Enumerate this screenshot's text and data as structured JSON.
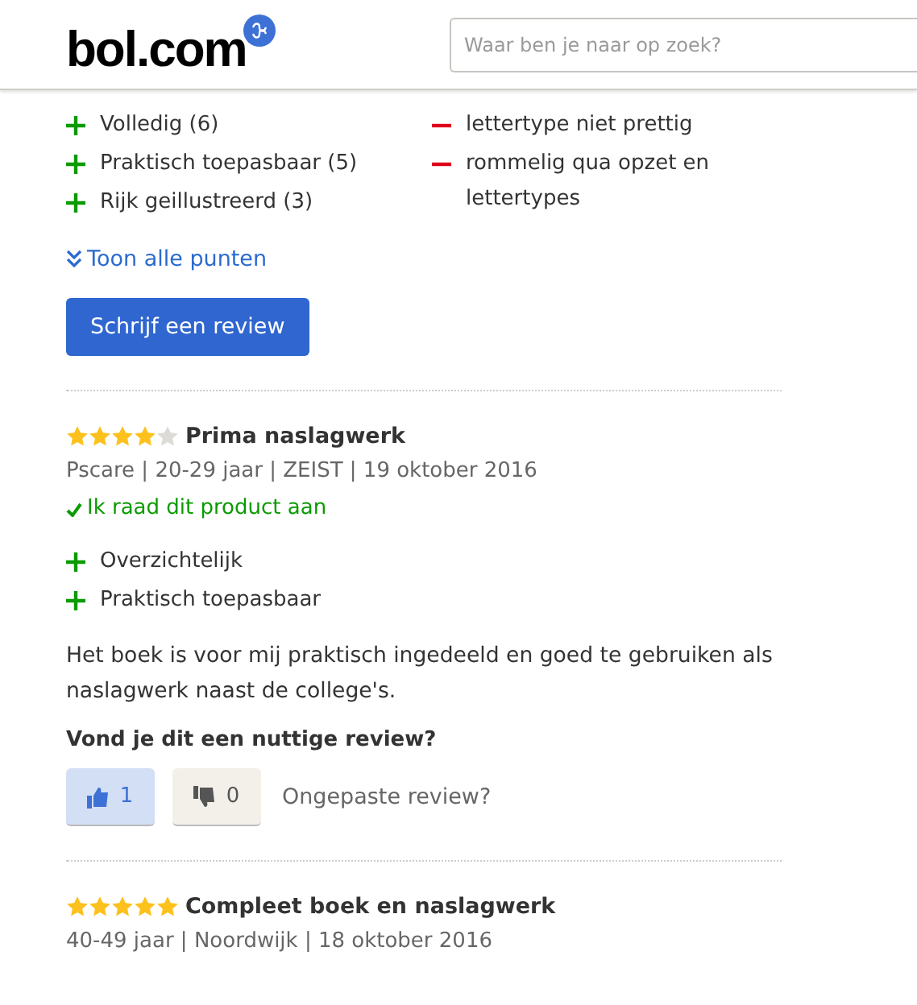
{
  "header": {
    "logo": "bol.com",
    "search": {
      "placeholder": "Waar ben je naar op zoek?"
    }
  },
  "summary": {
    "pros": [
      "Volledig (6)",
      "Praktisch toepasbaar (5)",
      "Rijk geillustreerd (3)"
    ],
    "cons": [
      "lettertype niet prettig",
      "rommelig qua opzet en lettertypes"
    ],
    "show_all": "Toon alle punten",
    "write_button": "Schrijf een review"
  },
  "reviews": [
    {
      "stars": 4,
      "title": "Prima naslagwerk",
      "meta": "Pscare | 20-29 jaar | ZEIST | 19 oktober 2016",
      "recommend": "Ik raad dit product aan",
      "pros": [
        "Overzichtelijk",
        "Praktisch toepasbaar"
      ],
      "body": "Het boek is voor mij praktisch ingedeeld en goed te gebruiken als naslagwerk naast de college's.",
      "question": "Vond je dit een nuttige review?",
      "votes": [
        {
          "kind": "up",
          "count": "1",
          "selected": true
        },
        {
          "kind": "down",
          "count": "0",
          "selected": false
        }
      ],
      "report": "Ongepaste review?"
    },
    {
      "stars": 5,
      "title": "Compleet boek en naslagwerk",
      "meta": "40-49 jaar | Noordwijk | 18 oktober 2016"
    }
  ]
}
